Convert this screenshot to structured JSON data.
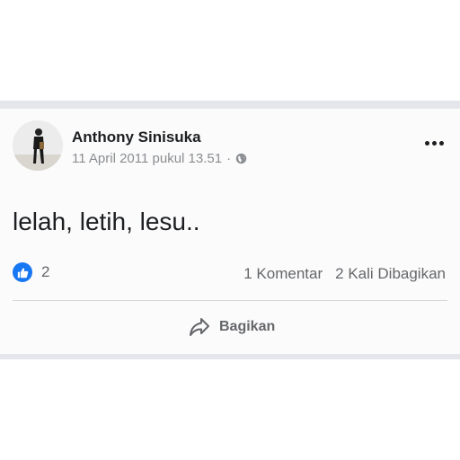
{
  "post": {
    "author": "Anthony Sinisuka",
    "timestamp": "11 April 2011 pukul 13.51",
    "separator": "·",
    "privacy_icon": "globe-icon",
    "text": "lelah, letih, lesu..",
    "reactions": {
      "icon": "like-icon",
      "count": "2"
    },
    "comments_label": "1 Komentar",
    "shares_label": "2 Kali Dibagikan",
    "share_button_label": "Bagikan"
  },
  "colors": {
    "like_blue": "#1877f2",
    "text_primary": "#1c1e21",
    "text_secondary": "#65676b",
    "divider": "#e4e6eb"
  }
}
